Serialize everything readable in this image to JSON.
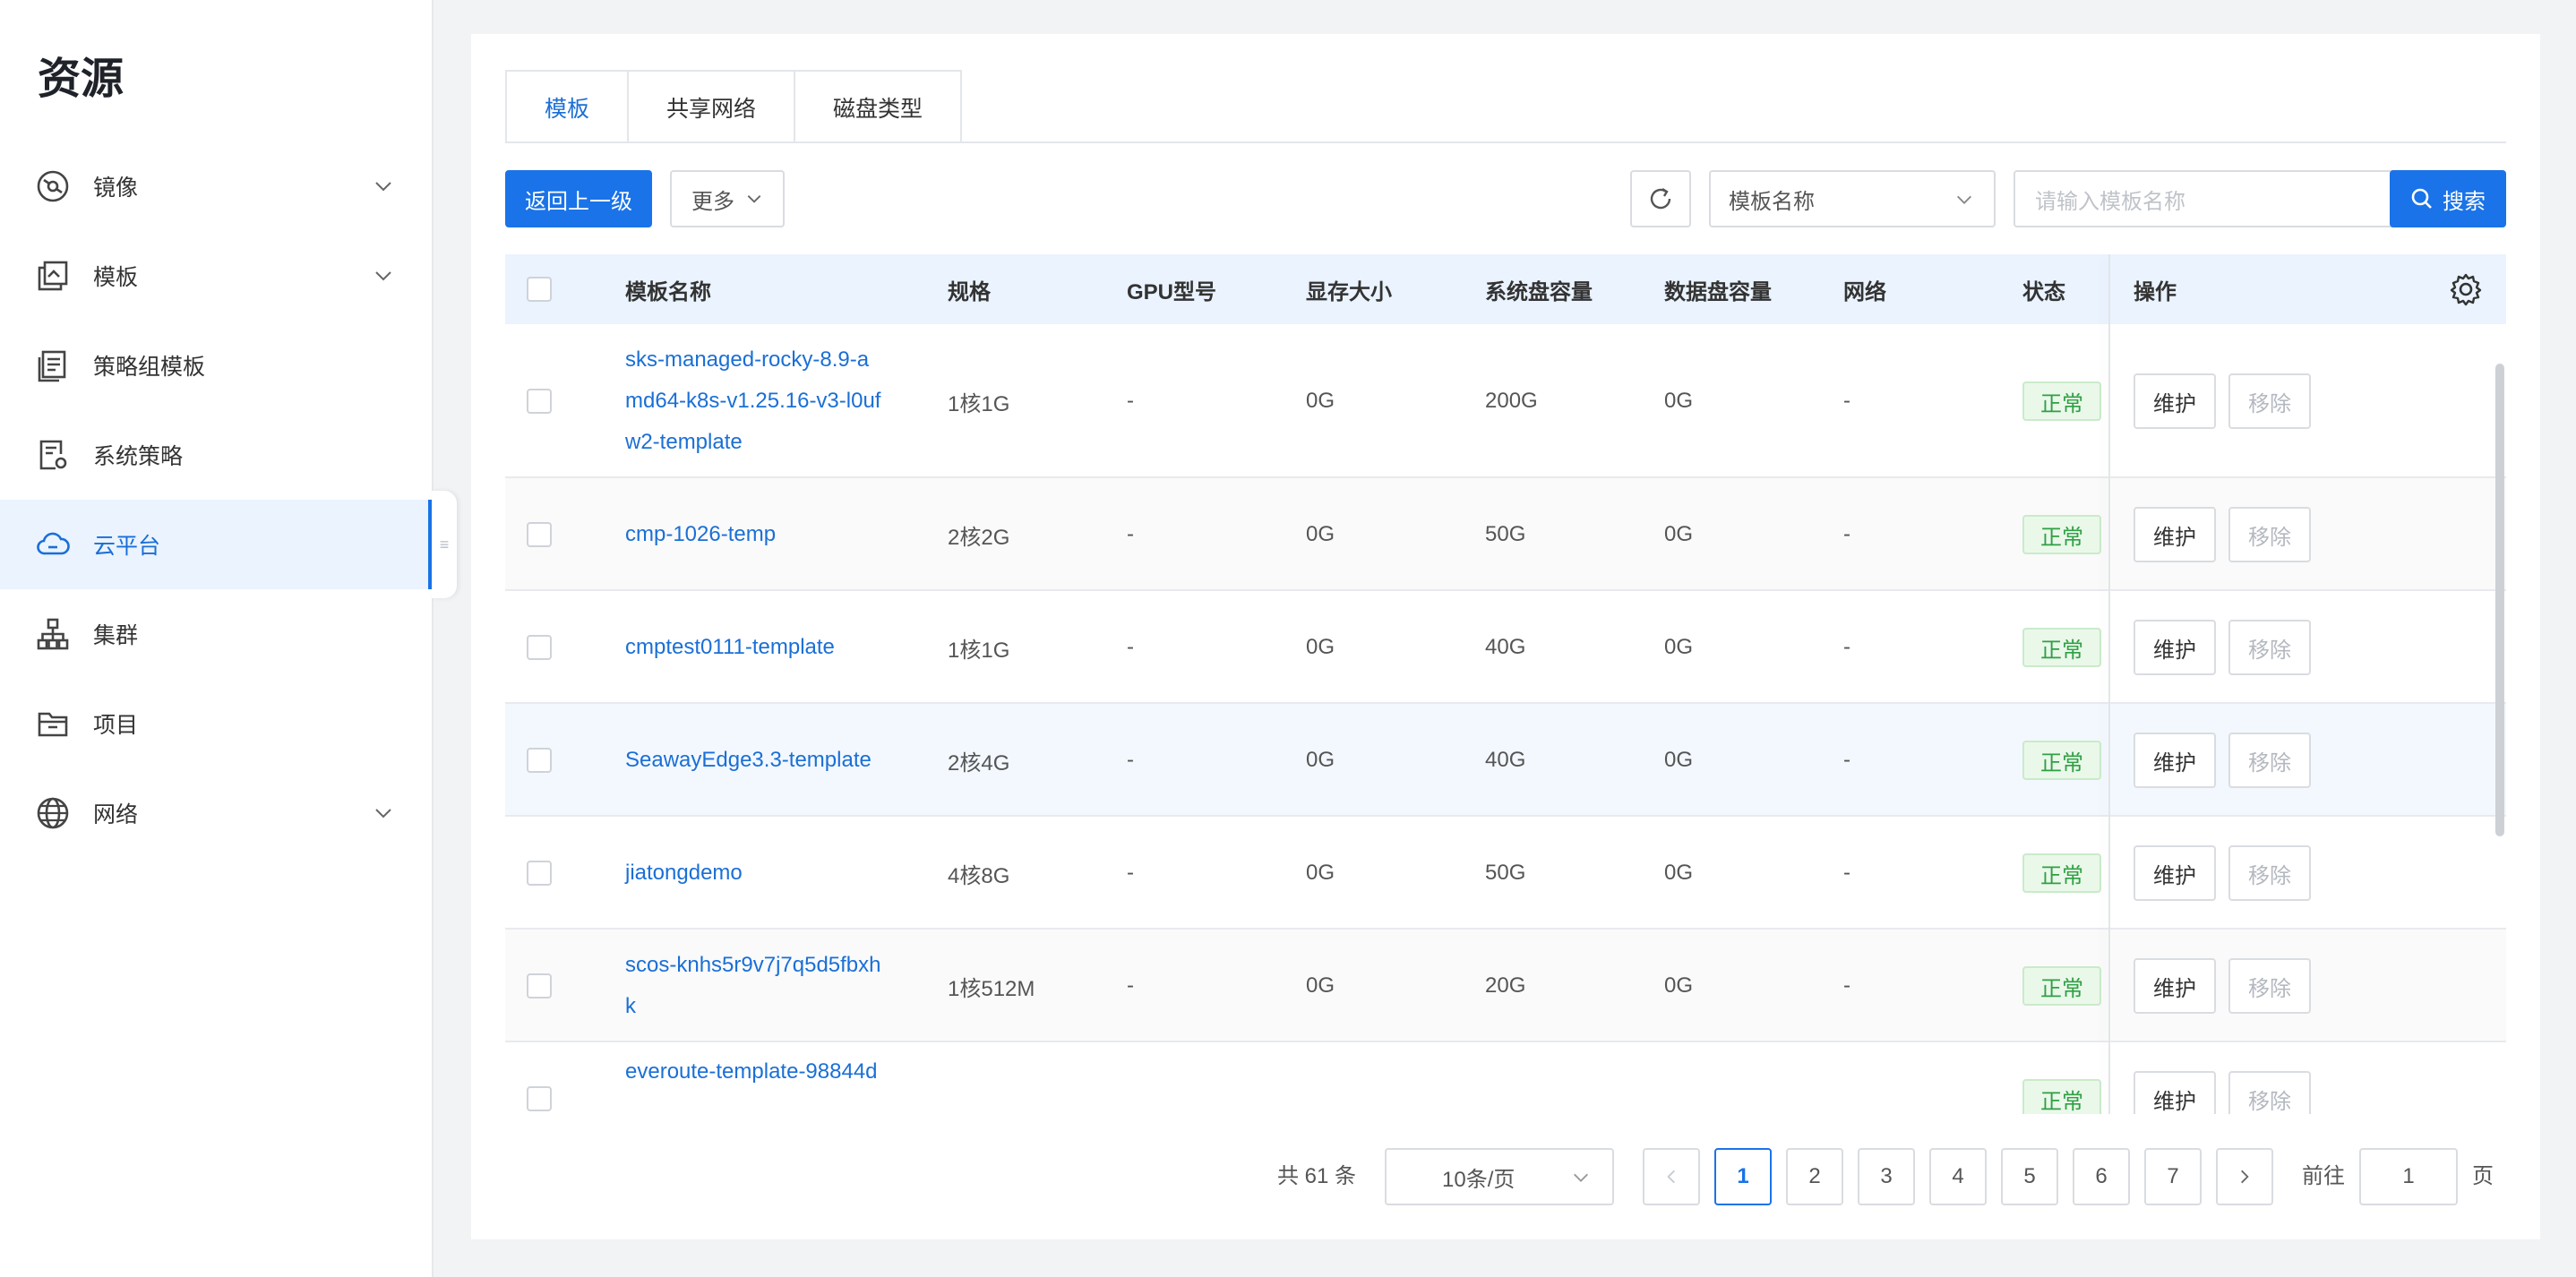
{
  "sidebar": {
    "title": "资源",
    "items": [
      {
        "label": "镜像",
        "icon": "disc-icon",
        "expandable": true
      },
      {
        "label": "模板",
        "icon": "template-icon",
        "expandable": true
      },
      {
        "label": "策略组模板",
        "icon": "policy-group-icon",
        "expandable": false
      },
      {
        "label": "系统策略",
        "icon": "system-policy-icon",
        "expandable": false
      },
      {
        "label": "云平台",
        "icon": "cloud-icon",
        "expandable": false,
        "active": true
      },
      {
        "label": "集群",
        "icon": "cluster-icon",
        "expandable": false
      },
      {
        "label": "项目",
        "icon": "folder-icon",
        "expandable": false
      },
      {
        "label": "网络",
        "icon": "globe-icon",
        "expandable": true
      }
    ]
  },
  "tabs": [
    "模板",
    "共享网络",
    "磁盘类型"
  ],
  "toolbar": {
    "back": "返回上一级",
    "more": "更多",
    "filter_field": "模板名称",
    "search_placeholder": "请输入模板名称",
    "search": "搜索"
  },
  "table": {
    "headers": [
      "模板名称",
      "规格",
      "GPU型号",
      "显存大小",
      "系统盘容量",
      "数据盘容量",
      "网络",
      "状态",
      "操作"
    ],
    "rows": [
      {
        "name_lines": [
          "sks-managed-rocky-8.9-a",
          "md64-k8s-v1.25.16-v3-l0uf",
          "w2-template"
        ],
        "spec": "1核1G",
        "gpu": "-",
        "vram": "0G",
        "sys": "200G",
        "data": "0G",
        "net": "-",
        "status": "正常"
      },
      {
        "name_lines": [
          "cmp-1026-temp"
        ],
        "spec": "2核2G",
        "gpu": "-",
        "vram": "0G",
        "sys": "50G",
        "data": "0G",
        "net": "-",
        "status": "正常"
      },
      {
        "name_lines": [
          "cmptest0111-template"
        ],
        "spec": "1核1G",
        "gpu": "-",
        "vram": "0G",
        "sys": "40G",
        "data": "0G",
        "net": "-",
        "status": "正常"
      },
      {
        "name_lines": [
          "SeawayEdge3.3-template"
        ],
        "spec": "2核4G",
        "gpu": "-",
        "vram": "0G",
        "sys": "40G",
        "data": "0G",
        "net": "-",
        "status": "正常"
      },
      {
        "name_lines": [
          "jiatongdemo"
        ],
        "spec": "4核8G",
        "gpu": "-",
        "vram": "0G",
        "sys": "50G",
        "data": "0G",
        "net": "-",
        "status": "正常"
      },
      {
        "name_lines": [
          "scos-knhs5r9v7j7q5d5fbxh",
          "k"
        ],
        "spec": "1核512M",
        "gpu": "-",
        "vram": "0G",
        "sys": "20G",
        "data": "0G",
        "net": "-",
        "status": "正常"
      },
      {
        "name_lines": [
          "everoute-template-98844d"
        ],
        "spec": "",
        "gpu": "",
        "vram": "",
        "sys": "",
        "data": "",
        "net": "",
        "status": "正常"
      }
    ],
    "actions": {
      "maintain": "维护",
      "remove": "移除"
    }
  },
  "pagination": {
    "total": "共 61 条",
    "page_size": "10条/页",
    "pages": [
      "1",
      "2",
      "3",
      "4",
      "5",
      "6",
      "7"
    ],
    "current": "1",
    "goto_label": "前往",
    "goto_value": "1",
    "page_suffix": "页"
  }
}
